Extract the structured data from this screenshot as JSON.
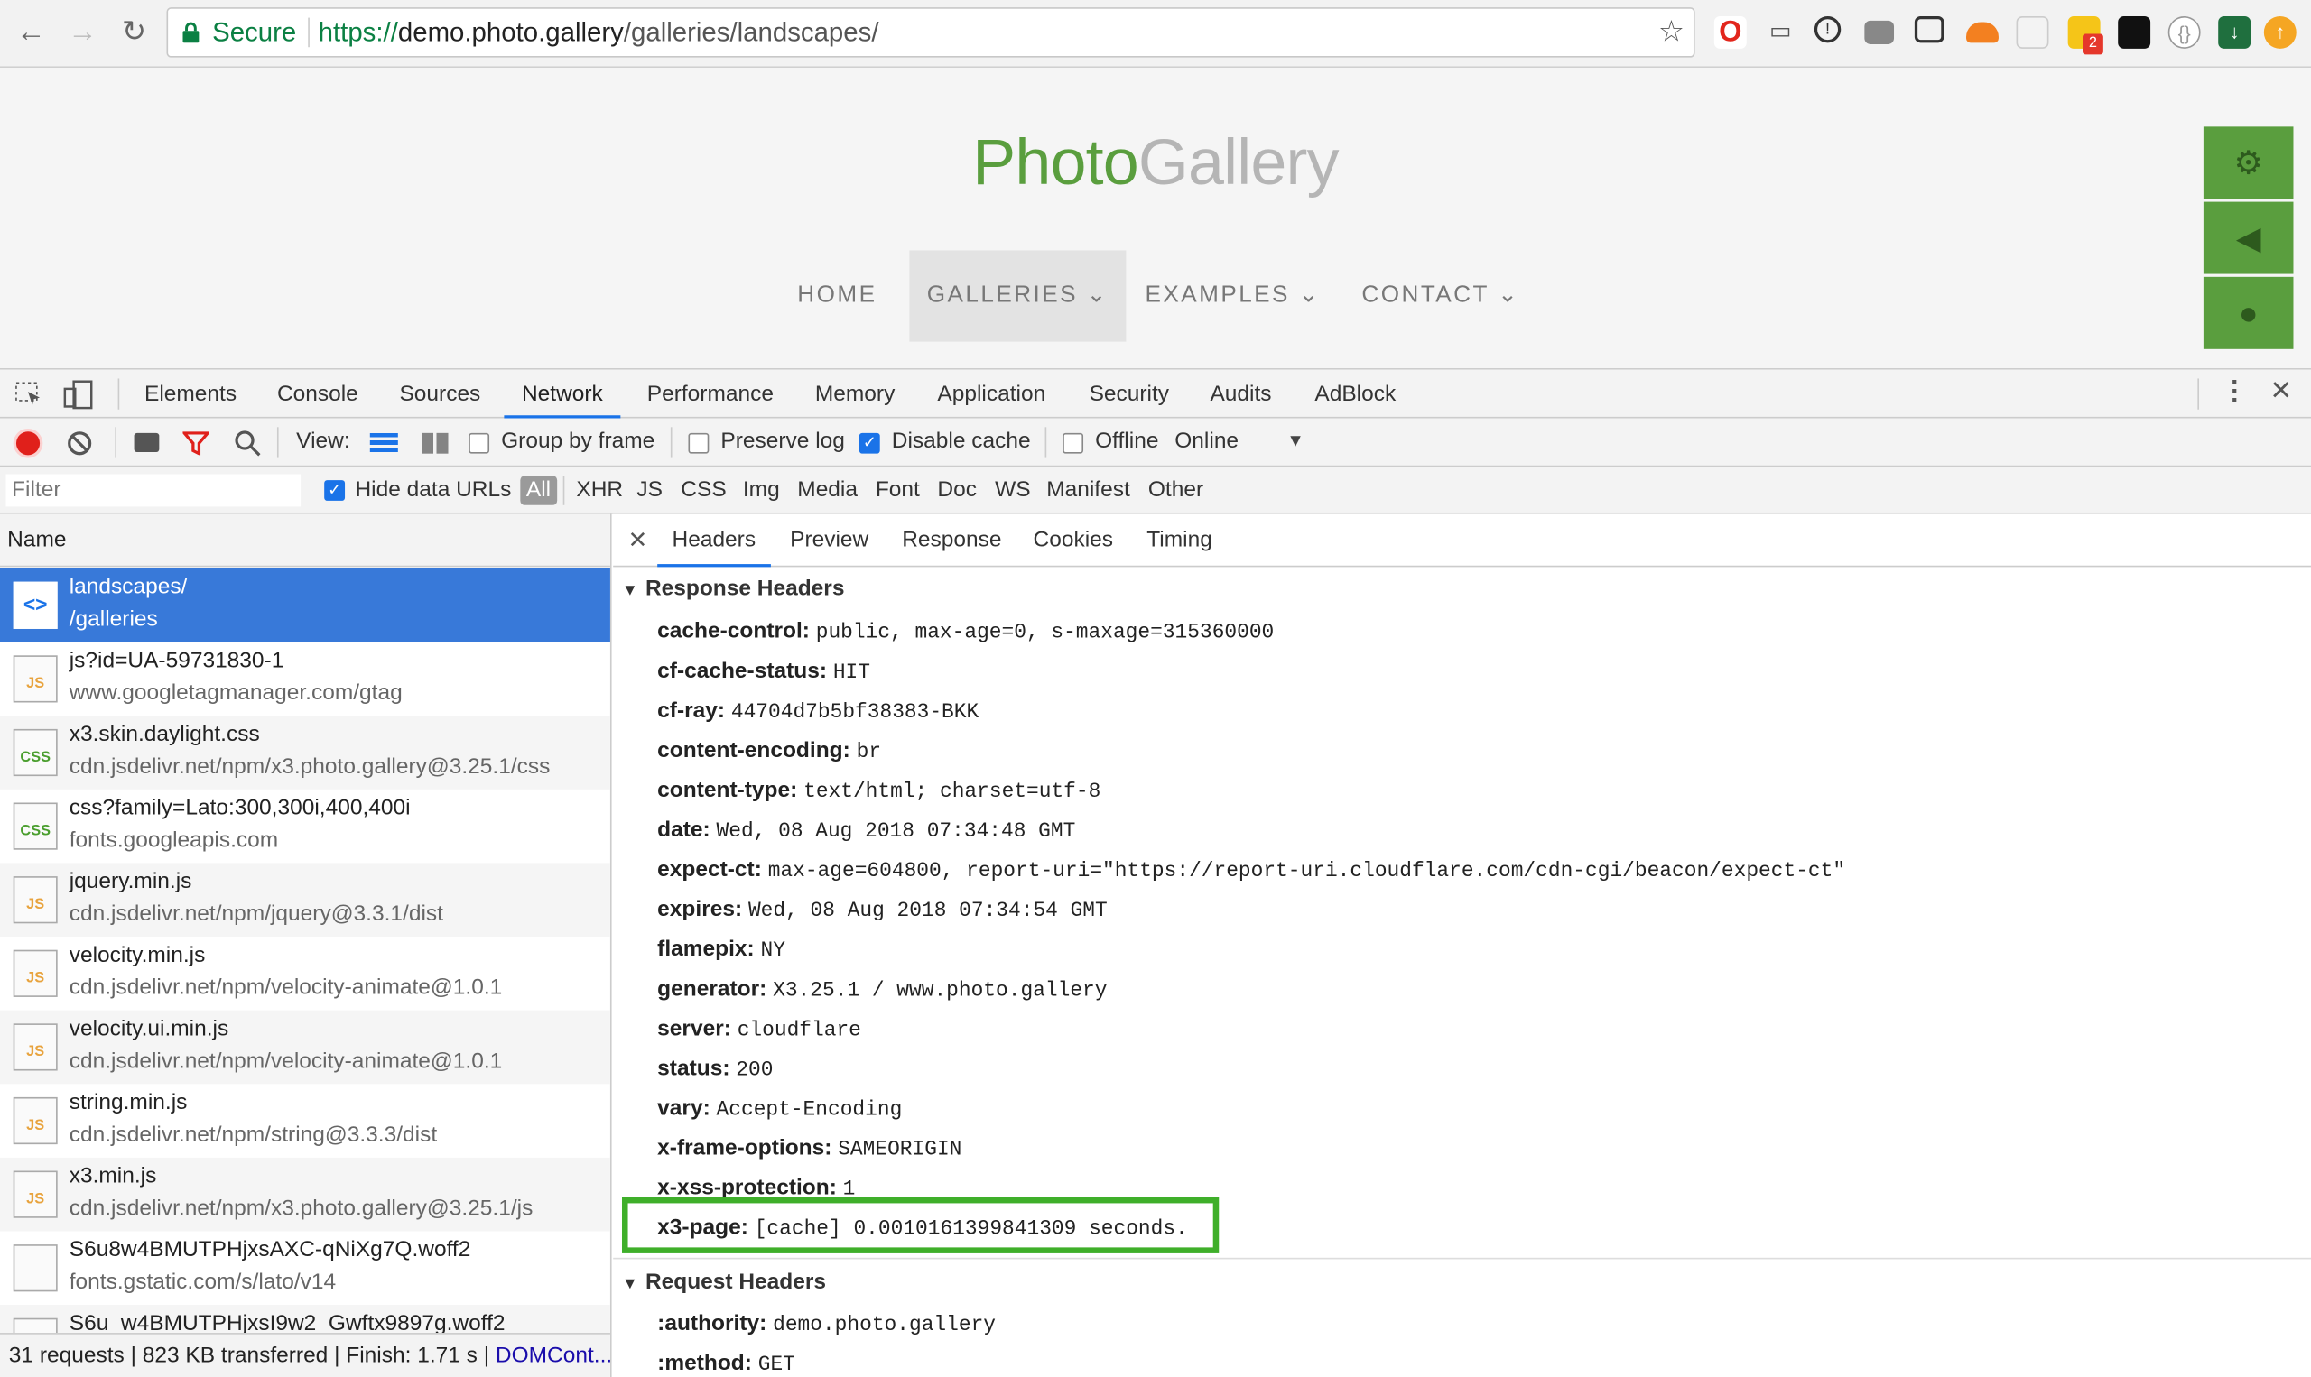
{
  "browser": {
    "secure_label": "Secure",
    "url_scheme": "https://",
    "url_domain": "demo.photo.gallery",
    "url_path": "/galleries/landscapes/",
    "ext_badge": "2"
  },
  "page": {
    "logo_part1": "Photo",
    "logo_part2": "Gallery",
    "menu": [
      "HOME",
      "GALLERIES ⌄",
      "EXAMPLES ⌄",
      "CONTACT ⌄"
    ]
  },
  "devtools": {
    "tabs": [
      "Elements",
      "Console",
      "Sources",
      "Network",
      "Performance",
      "Memory",
      "Application",
      "Security",
      "Audits",
      "AdBlock"
    ],
    "toolbar": {
      "view": "View:",
      "group": "Group by frame",
      "preserve": "Preserve log",
      "disable": "Disable cache",
      "offline": "Offline",
      "online": "Online"
    },
    "filter": {
      "placeholder": "Filter",
      "hide_data": "Hide data URLs",
      "types": [
        "All",
        "XHR",
        "JS",
        "CSS",
        "Img",
        "Media",
        "Font",
        "Doc",
        "WS",
        "Manifest",
        "Other"
      ]
    },
    "name_header": "Name",
    "requests": [
      {
        "name": "landscapes/",
        "path": "/galleries",
        "type": "<>"
      },
      {
        "name": "js?id=UA-59731830-1",
        "path": "www.googletagmanager.com/gtag",
        "type": "JS"
      },
      {
        "name": "x3.skin.daylight.css",
        "path": "cdn.jsdelivr.net/npm/x3.photo.gallery@3.25.1/css",
        "type": "CSS"
      },
      {
        "name": "css?family=Lato:300,300i,400,400i",
        "path": "fonts.googleapis.com",
        "type": "CSS"
      },
      {
        "name": "jquery.min.js",
        "path": "cdn.jsdelivr.net/npm/jquery@3.3.1/dist",
        "type": "JS"
      },
      {
        "name": "velocity.min.js",
        "path": "cdn.jsdelivr.net/npm/velocity-animate@1.0.1",
        "type": "JS"
      },
      {
        "name": "velocity.ui.min.js",
        "path": "cdn.jsdelivr.net/npm/velocity-animate@1.0.1",
        "type": "JS"
      },
      {
        "name": "string.min.js",
        "path": "cdn.jsdelivr.net/npm/string@3.3.3/dist",
        "type": "JS"
      },
      {
        "name": "x3.min.js",
        "path": "cdn.jsdelivr.net/npm/x3.photo.gallery@3.25.1/js",
        "type": "JS"
      },
      {
        "name": "S6u8w4BMUTPHjxsAXC-qNiXg7Q.woff2",
        "path": "fonts.gstatic.com/s/lato/v14",
        "type": ""
      },
      {
        "name": "S6u_w4BMUTPHjxsI9w2_Gwftx9897g.woff2",
        "path": "",
        "type": ""
      }
    ],
    "status": {
      "text": "31 requests | 823 KB transferred | Finish: 1.71 s | ",
      "link": "DOMCont..."
    },
    "detail_tabs": [
      "Headers",
      "Preview",
      "Response",
      "Cookies",
      "Timing"
    ],
    "response_title": "Response Headers",
    "response_headers": [
      {
        "k": "cache-control:",
        "v": "public, max-age=0, s-maxage=315360000"
      },
      {
        "k": "cf-cache-status:",
        "v": "HIT"
      },
      {
        "k": "cf-ray:",
        "v": "44704d7b5bf38383-BKK"
      },
      {
        "k": "content-encoding:",
        "v": "br"
      },
      {
        "k": "content-type:",
        "v": "text/html; charset=utf-8"
      },
      {
        "k": "date:",
        "v": "Wed, 08 Aug 2018 07:34:48 GMT"
      },
      {
        "k": "expect-ct:",
        "v": "max-age=604800, report-uri=\"https://report-uri.cloudflare.com/cdn-cgi/beacon/expect-ct\""
      },
      {
        "k": "expires:",
        "v": "Wed, 08 Aug 2018 07:34:54 GMT"
      },
      {
        "k": "flamepix:",
        "v": "NY"
      },
      {
        "k": "generator:",
        "v": "X3.25.1 / www.photo.gallery"
      },
      {
        "k": "server:",
        "v": "cloudflare"
      },
      {
        "k": "status:",
        "v": "200"
      },
      {
        "k": "vary:",
        "v": "Accept-Encoding"
      },
      {
        "k": "x-frame-options:",
        "v": "SAMEORIGIN"
      },
      {
        "k": "x-xss-protection:",
        "v": "1"
      },
      {
        "k": "x3-page:",
        "v": "[cache] 0.0010161399841309 seconds."
      }
    ],
    "request_title": "Request Headers",
    "request_headers": [
      {
        "k": ":authority:",
        "v": "demo.photo.gallery"
      },
      {
        "k": ":method:",
        "v": "GET"
      }
    ]
  },
  "colors": {
    "brand_green": "#5a9e3e",
    "selection_blue": "#3879d9",
    "highlight_green": "#3faf2a"
  }
}
